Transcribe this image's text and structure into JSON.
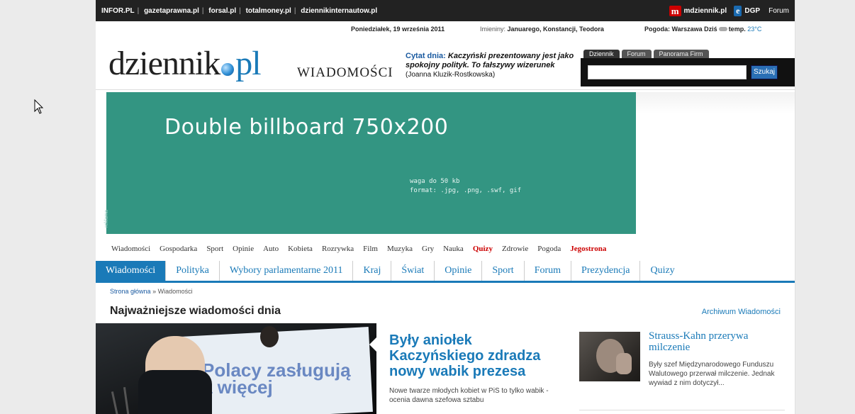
{
  "topbar": {
    "links": [
      "INFOR.PL",
      "gazetaprawna.pl",
      "forsal.pl",
      "totalmoney.pl",
      "dziennikinternautow.pl"
    ],
    "mdziennik_badge": "m",
    "mdziennik_label": "mdziennik.pl",
    "dgp_badge": "e",
    "dgp_label": "DGP",
    "forum_label": "Forum"
  },
  "infobar": {
    "date": "Poniedziałek, 19 września 2011",
    "names_label": "Imieniny:",
    "names": "Januarego, Konstancji, Teodora",
    "weather": "Pogoda: Warszawa Dziś",
    "temp_label": "temp.",
    "temp_value": "23°C"
  },
  "header": {
    "logo_main": "dziennik",
    "logo_pl": "pl",
    "section": "WIADOMOŚCI",
    "quote_label": "Cytat dnia:",
    "quote_text": "Kaczyński prezentowany jest jako spokojny polityk. To fałszywy wizerunek",
    "quote_author": "(Joanna Kluzik-Rostkowska)"
  },
  "search": {
    "tabs": [
      "Dziennik",
      "Forum",
      "Panorama Firm"
    ],
    "placeholder": "",
    "button": "Szukaj"
  },
  "billboard": {
    "title": "Double billboard 750x200",
    "line1": "waga do 50 kb",
    "line2": "format: .jpg, .png, .swf, gif",
    "side_label": "reklama"
  },
  "catnav": [
    "Wiadomości",
    "Gospodarka",
    "Sport",
    "Opinie",
    "Auto",
    "Kobieta",
    "Rozrywka",
    "Film",
    "Muzyka",
    "Gry",
    "Nauka",
    "Quizy",
    "Zdrowie",
    "Pogoda",
    "Jegostrona"
  ],
  "mainnav": [
    "Wiadomości",
    "Polityka",
    "Wybory parlamentarne 2011",
    "Kraj",
    "Świat",
    "Opinie",
    "Sport",
    "Forum",
    "Prezydencja",
    "Quizy"
  ],
  "breadcrumb": {
    "home": "Strona główna",
    "sep": "»",
    "current": "Wiadomości"
  },
  "headline": {
    "title": "Najważniejsze wiadomości dnia",
    "archive": "Archiwum Wiadomości"
  },
  "photo": {
    "banner_line1": "Polacy zasługują",
    "banner_line2": "a więcej"
  },
  "story": {
    "title": "Były aniołek Kaczyńskiego zdradza nowy wabik prezesa",
    "lead": "Nowe twarze młodych kobiet w PiS to tylko wabik - ocenia dawna szefowa sztabu"
  },
  "side_story": {
    "title": "Strauss-Kahn przerywa milczenie",
    "lead": "Były szef Międzynarodowego Funduszu Walutowego przerwał milczenie. Jednak wywiad z nim dotyczył..."
  }
}
